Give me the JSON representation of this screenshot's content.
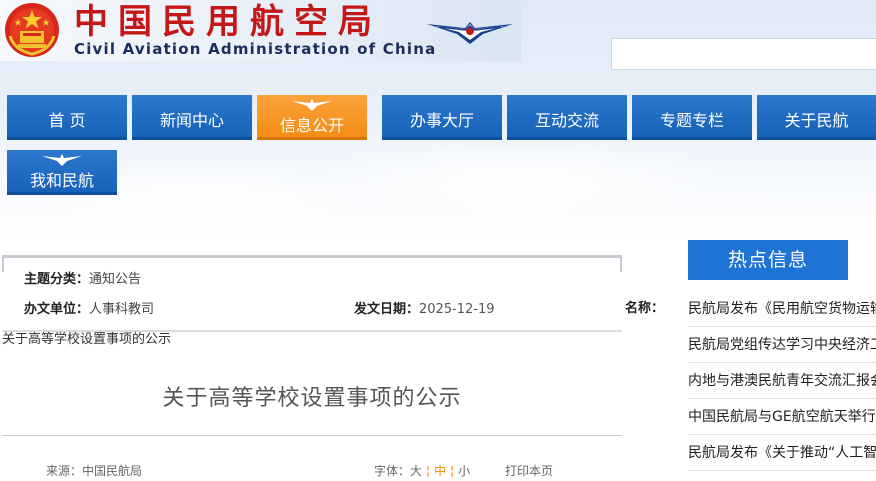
{
  "header": {
    "title_cn": "中国民用航空局",
    "title_en": "Civil Aviation Administration of China"
  },
  "nav": [
    {
      "label": "首 页"
    },
    {
      "label": "新闻中心"
    },
    {
      "label": "信息公开"
    },
    {
      "label": "办事大厅"
    },
    {
      "label": "互动交流"
    },
    {
      "label": "专题专栏"
    },
    {
      "label": "关于民航"
    },
    {
      "label": "我和民航"
    }
  ],
  "info": {
    "topic_label": "主题分类：",
    "topic_value": "通知公告",
    "unit_label": "办文单位：",
    "unit_value": "人事科教司",
    "date_label": "发文日期：",
    "date_value": "2025-12-19",
    "name_label": "名称："
  },
  "article": {
    "breadcrumb": "关于高等学校设置事项的公示",
    "title": "关于高等学校设置事项的公示",
    "source": "来源：中国民航局",
    "font_label": "字体：",
    "font_large": "大",
    "font_medium": "中",
    "font_small": "小",
    "print": "打印本页"
  },
  "hot": {
    "title": "热点信息",
    "items": [
      "民航局发布《民用航空货物运输",
      "民航局党组传达学习中央经济工",
      "内地与港澳民航青年交流汇报会",
      "中国民航局与GE航空航天举行",
      "民航局发布《关于推动“人工智"
    ]
  },
  "colors": {
    "nav_blue": "#1f6cc6",
    "nav_active": "#f7961f",
    "title_red": "#c41818",
    "hot_blue": "#1f73d4"
  }
}
